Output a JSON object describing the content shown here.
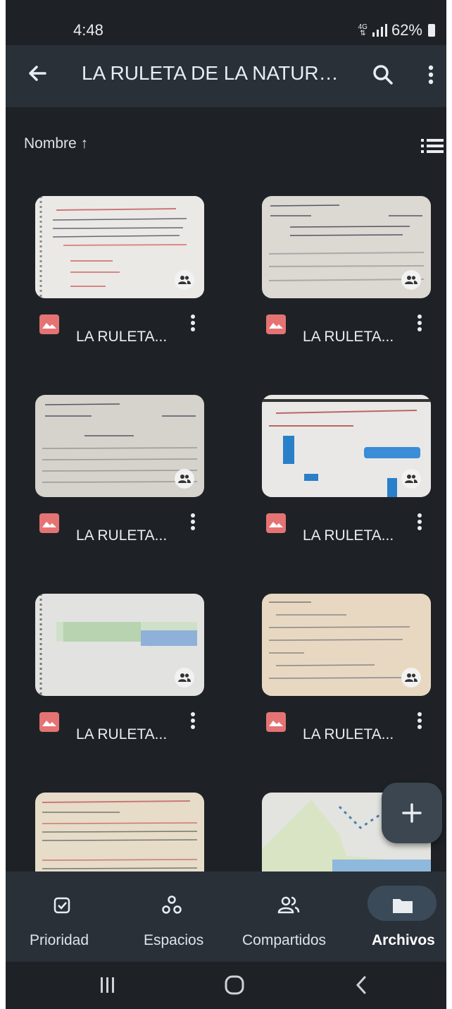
{
  "status": {
    "time": "4:48",
    "network": "4G",
    "battery": "62%"
  },
  "appbar": {
    "title": "LA RULETA DE LA NATURAL...",
    "back_icon": "arrow-back-icon",
    "search_icon": "search-icon",
    "more_icon": "more-vert-icon"
  },
  "sort": {
    "label": "Nombre ↑",
    "view_icon": "list-view-icon"
  },
  "files": [
    {
      "name": "LA RULETA...",
      "type_icon": "image-icon",
      "shared": true
    },
    {
      "name": "LA RULETA...",
      "type_icon": "image-icon",
      "shared": true
    },
    {
      "name": "LA RULETA...",
      "type_icon": "image-icon",
      "shared": true
    },
    {
      "name": "LA RULETA...",
      "type_icon": "image-icon",
      "shared": true
    },
    {
      "name": "LA RULETA...",
      "type_icon": "image-icon",
      "shared": true
    },
    {
      "name": "LA RULETA...",
      "type_icon": "image-icon",
      "shared": true
    }
  ],
  "fab": {
    "icon": "plus-icon"
  },
  "bottom_nav": {
    "items": [
      {
        "label": "Prioridad",
        "icon": "priority-check-icon",
        "active": false
      },
      {
        "label": "Espacios",
        "icon": "spaces-icon",
        "active": false
      },
      {
        "label": "Compartidos",
        "icon": "shared-people-icon",
        "active": false
      },
      {
        "label": "Archivos",
        "icon": "folder-icon",
        "active": true
      }
    ]
  },
  "colors": {
    "background": "#1e2226",
    "appbar": "#293038",
    "file_icon": "#e57373",
    "text": "#e9edf1"
  }
}
